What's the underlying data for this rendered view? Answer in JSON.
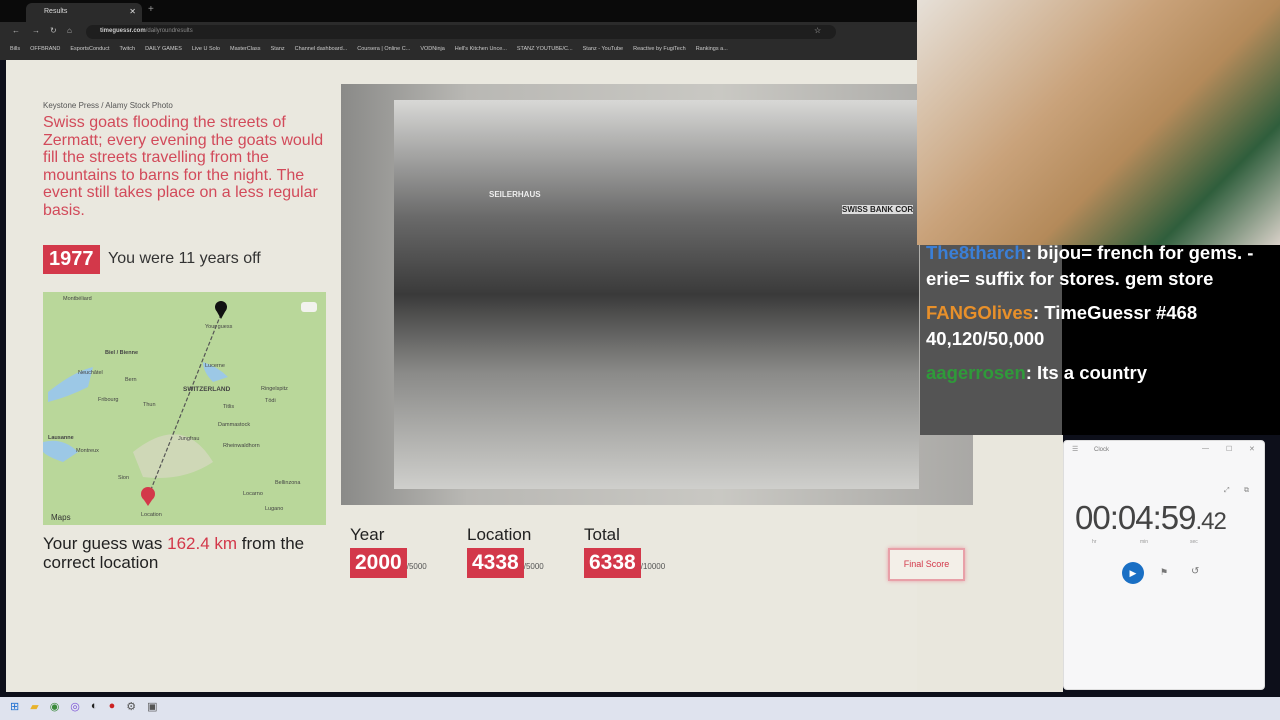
{
  "browser": {
    "tab_title": "Results",
    "url_domain": "timeguessr.com",
    "url_path": "/dailyroundresults",
    "bookmarks": [
      "Bills",
      "OFFBRAND",
      "EsportsConduct",
      "Twitch",
      "DAILY GAMES",
      "Live U Solo",
      "MasterClass",
      "Stanz",
      "Channel dashboard...",
      "Coursera | Online C...",
      "VODNinja",
      "Hell's Kitchen Unce...",
      "STANZ YOUTUBE/C...",
      "Stanz - YouTube",
      "Reactive by FugiTech",
      "Rankings a..."
    ]
  },
  "result": {
    "credit": "Keystone Press / Alamy Stock Photo",
    "description": "Swiss goats flooding the streets of Zermatt; every evening the goats would fill the streets travelling from the mountains to barns for the night. The event still takes place on a less regular basis.",
    "year": "1977",
    "year_diff": "You were 11 years off",
    "guess_prefix": "Your guess was ",
    "guess_distance": "162.4 km",
    "guess_suffix": " from the correct location",
    "photo_signs": [
      "SEILERHAUS",
      "SWISS BANK COR"
    ]
  },
  "map": {
    "labels": {
      "montbeliard": "Montbéliard",
      "biel": "Biel / Bienne",
      "neuchatel": "Neuchâtel",
      "bern": "Bern",
      "fribourg": "Fribourg",
      "thun": "Thun",
      "country": "SWITZERLAND",
      "lucerne": "Lucerne",
      "your_guess": "Your guess",
      "location": "Location",
      "lausanne": "Lausanne",
      "montreux": "Montreux",
      "sion": "Sion",
      "jungfrau": "Jungfrau",
      "titlis": "Titlis",
      "dammastock": "Dammastock",
      "lugano": "Lugano",
      "locarno": "Locarno",
      "bellinzona": "Bellinzona",
      "rheinwaldhorn": "Rheinwaldhorn",
      "ringelspitz": "Ringelspitz",
      "todi": "Tödi"
    },
    "attribution": "Maps"
  },
  "scores": [
    {
      "label": "Year",
      "value": "2000",
      "max": "/5000"
    },
    {
      "label": "Location",
      "value": "4338",
      "max": "/5000"
    },
    {
      "label": "Total",
      "value": "6338",
      "max": "/10000"
    }
  ],
  "final_score_label": "Final Score",
  "chat": [
    {
      "user": "The8tharch",
      "user_color": "#3b7fd6",
      "text": ": bijou= french for gems. -erie= suffix for stores. gem store"
    },
    {
      "user": "FANGOlives",
      "user_color": "#e8902a",
      "text": ": TimeGuessr #468 40,120/50,000"
    },
    {
      "user": "aagerrosen",
      "user_color": "#2f9a3a",
      "text": ": Its a country"
    }
  ],
  "clock": {
    "title": "Clock",
    "time_main": "00:04:59",
    "time_frac": ".42",
    "units": [
      "hr",
      "min",
      "sec"
    ]
  },
  "colors": {
    "accent": "#d3384a",
    "page_bg": "#eae8df"
  }
}
